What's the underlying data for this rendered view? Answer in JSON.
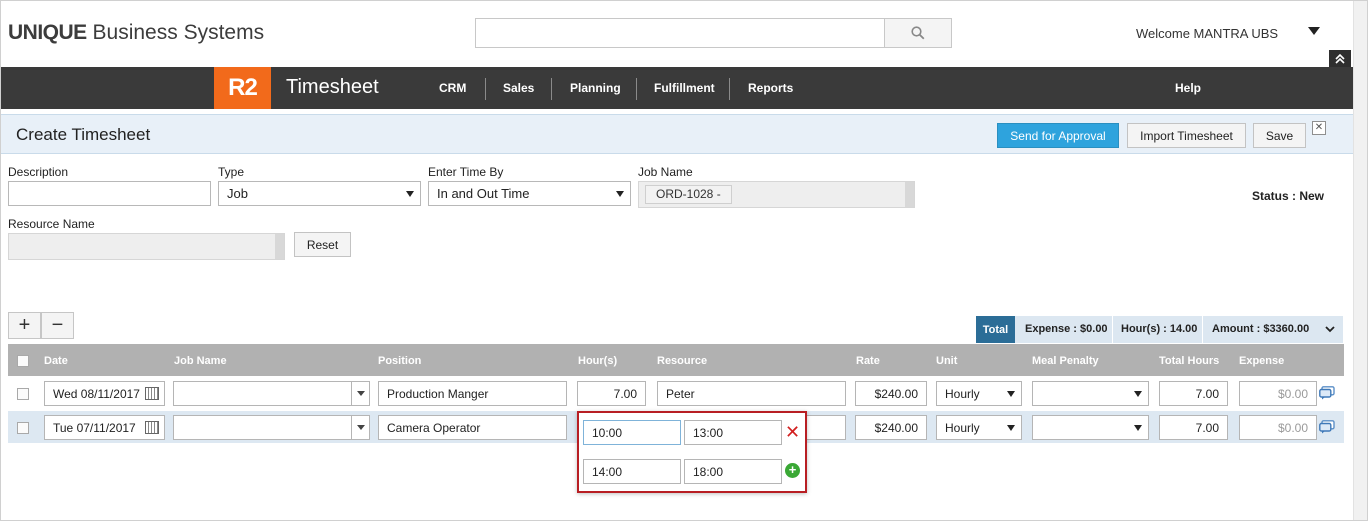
{
  "brand": {
    "bold": "UNIQUE",
    "rest": " Business Systems"
  },
  "search": {
    "placeholder": ""
  },
  "user": {
    "welcome": "Welcome MANTRA UBS"
  },
  "nav": {
    "logo": "R2",
    "module": "Timesheet",
    "items": [
      "CRM",
      "Sales",
      "Planning",
      "Fulfillment",
      "Reports"
    ],
    "help": "Help"
  },
  "page": {
    "title": "Create Timesheet",
    "actions": {
      "send": "Send for Approval",
      "import": "Import Timesheet",
      "save": "Save"
    }
  },
  "form": {
    "description": {
      "label": "Description",
      "value": ""
    },
    "type": {
      "label": "Type",
      "value": "Job"
    },
    "enter_time_by": {
      "label": "Enter Time By",
      "value": "In and Out Time"
    },
    "job_name": {
      "label": "Job Name",
      "value": "ORD-1028 -"
    },
    "resource_name": {
      "label": "Resource Name",
      "value": ""
    },
    "reset": "Reset",
    "status": "Status : New"
  },
  "toolbar": {
    "add": "+",
    "remove": "−"
  },
  "totals": {
    "tab": "Total",
    "expense": "Expense : $0.00",
    "hours": "Hour(s) : 14.00",
    "amount": "Amount : $3360.00"
  },
  "grid": {
    "headers": [
      "Date",
      "Job Name",
      "Position",
      "Hour(s)",
      "Resource",
      "Rate",
      "Unit",
      "Meal Penalty",
      "Total Hours",
      "Expense"
    ],
    "rows": [
      {
        "date": "Wed 08/11/2017",
        "job": "",
        "position": "Production Manger",
        "hours": "7.00",
        "resource": "Peter",
        "rate": "$240.00",
        "unit": "Hourly",
        "meal": "",
        "total": "7.00",
        "expense": "$0.00"
      },
      {
        "date": "Tue 07/11/2017",
        "job": "",
        "position": "Camera Operator",
        "hours": "",
        "resource": "",
        "rate": "$240.00",
        "unit": "Hourly",
        "meal": "",
        "total": "7.00",
        "expense": "$0.00"
      }
    ]
  },
  "popup": {
    "slots": [
      {
        "in": "10:00",
        "out": "13:00"
      },
      {
        "in": "14:00",
        "out": "18:00"
      }
    ]
  },
  "colors": {
    "accent": "#f26a1b",
    "primary": "#2ea3dd",
    "nav": "#3a3a3a",
    "danger": "#d21f1f",
    "success": "#3aa835"
  }
}
